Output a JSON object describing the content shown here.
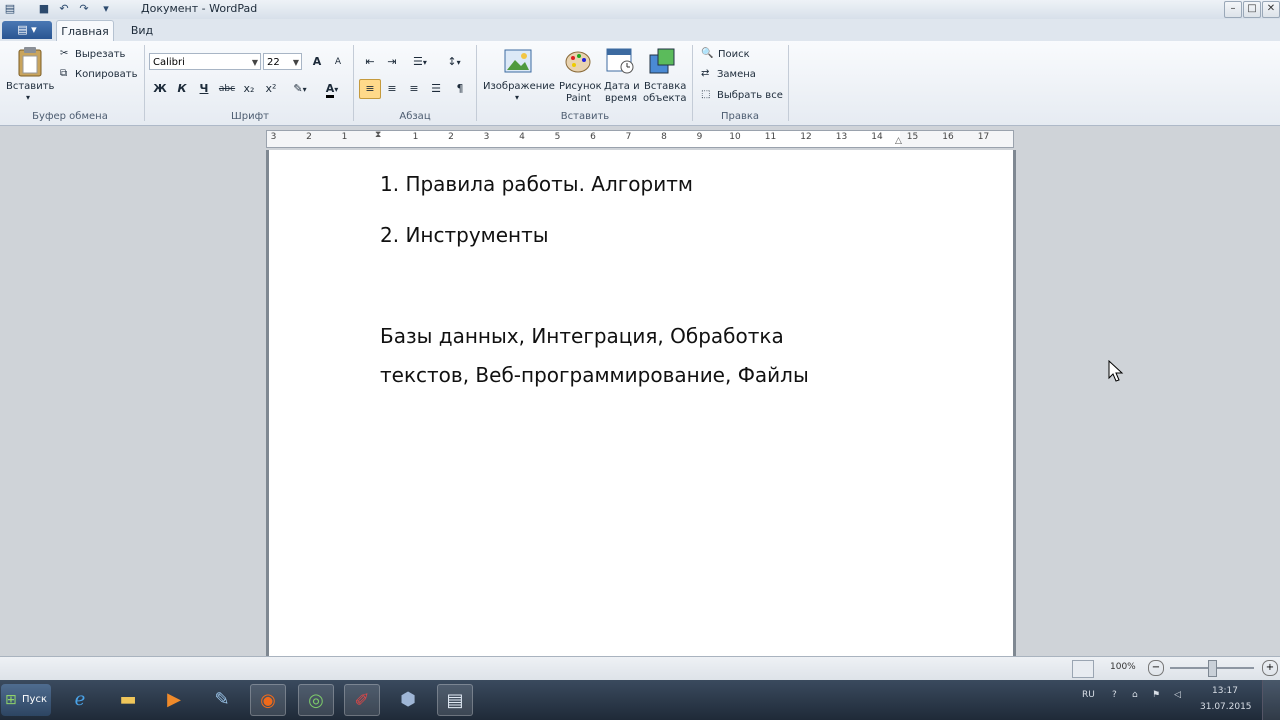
{
  "window": {
    "title": "Документ - WordPad"
  },
  "quick_access": {
    "icons": [
      "save-icon",
      "undo-icon",
      "redo-icon",
      "customize-icon"
    ]
  },
  "window_controls": {
    "minimize": "–",
    "maximize": "□",
    "close": "✕"
  },
  "tabs": {
    "home": "Главная",
    "view": "Вид"
  },
  "clipboard": {
    "group_label": "Буфер обмена",
    "paste": "Вставить",
    "cut": "Вырезать",
    "copy": "Копировать"
  },
  "font": {
    "group_label": "Шрифт",
    "family": "Calibri",
    "size": "22",
    "bold": "Ж",
    "italic": "К",
    "underline": "Ч",
    "strikethrough": "abc",
    "subscript": "x₂",
    "superscript": "x²",
    "grow": "A",
    "shrink": "A"
  },
  "paragraph": {
    "group_label": "Абзац"
  },
  "insert": {
    "group_label": "Вставить",
    "picture": "Изображение",
    "paint_line1": "Рисунок",
    "paint_line2": "Paint",
    "datetime_line1": "Дата и",
    "datetime_line2": "время",
    "object_line1": "Вставка",
    "object_line2": "объекта"
  },
  "editing": {
    "group_label": "Правка",
    "find": "Поиск",
    "replace": "Замена",
    "select_all": "Выбрать все"
  },
  "ruler": {
    "numbers": [
      "3",
      "2",
      "1",
      "1",
      "2",
      "3",
      "4",
      "5",
      "6",
      "7",
      "8",
      "9",
      "10",
      "11",
      "12",
      "13",
      "14",
      "15",
      "16",
      "17"
    ]
  },
  "document": {
    "lines": [
      "1. Правила работы. Алгоритм",
      "2. Инструменты",
      "Базы данных, Интеграция, Обработка",
      "текстов, Веб-программирование, Файлы"
    ]
  },
  "status": {
    "zoom": "100%"
  },
  "taskbar": {
    "start": "Пуск",
    "apps": [
      "ie-icon",
      "explorer-icon",
      "media-player-icon",
      "tool-icon",
      "firefox-icon",
      "chat-icon",
      "draw-icon",
      "virtualbox-icon",
      "wordpad-icon"
    ],
    "tray_lang": "RU",
    "time": "13:17",
    "date": "31.07.2015"
  },
  "colors": {
    "accent": "#2a5592",
    "selected": "#ffd98a",
    "taskbar": "#1f2a38"
  }
}
